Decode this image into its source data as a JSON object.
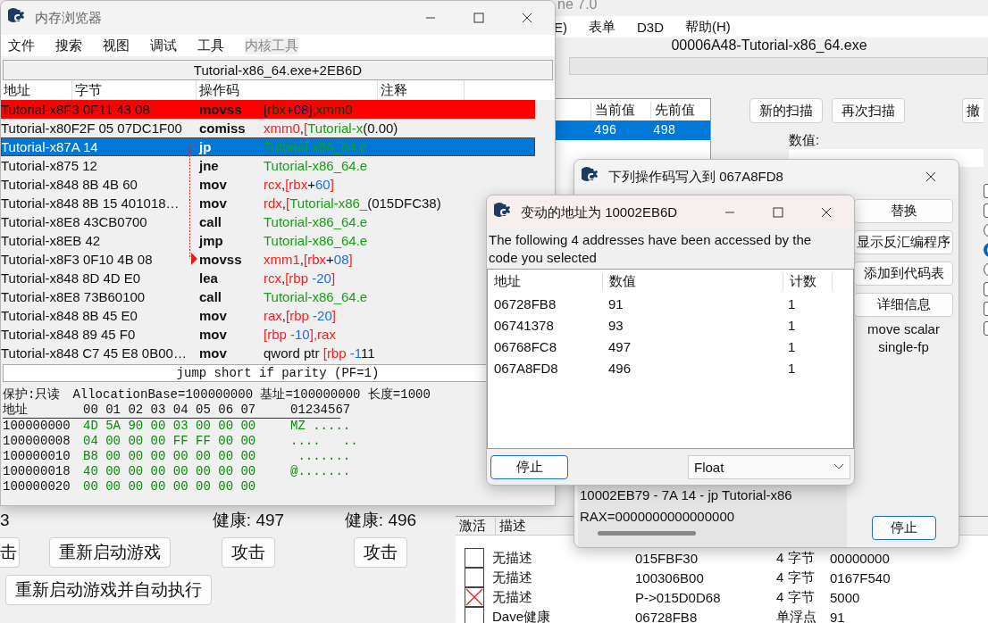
{
  "main_window": {
    "title": "ne 7.0",
    "menu": [
      "E)",
      "表单",
      "D3D",
      "帮助(H)"
    ],
    "process": "00006A48-Tutorial-x86_64.exe",
    "scan_list": {
      "columns": [
        "当前值",
        "先前值"
      ],
      "rows": [
        {
          "current": "496",
          "previous": "498",
          "selected": true
        }
      ]
    },
    "buttons": [
      "新的扫描",
      "再次扫描",
      "撤"
    ],
    "value_label": "数值:",
    "options": [
      {
        "kind": "checkbox",
        "checked": false
      },
      {
        "kind": "checkbox",
        "checked": false
      },
      {
        "kind": "radio",
        "checked": false
      },
      {
        "kind": "radio",
        "checked": true
      },
      {
        "kind": "radio",
        "checked": false
      },
      {
        "kind": "checkbox",
        "checked": false
      },
      {
        "kind": "checkbox",
        "checked": false
      },
      {
        "kind": "checkbox",
        "checked": false
      }
    ]
  },
  "tutorial": {
    "score": "3",
    "health": [
      "健康: 497",
      "健康: 496"
    ],
    "buttons": [
      "击",
      "重新启动游戏",
      "攻击",
      "攻击"
    ],
    "auto_button": "重新启动游戏并自动执行"
  },
  "address_list": {
    "columns": [
      "激活",
      "描述"
    ],
    "rows": [
      {
        "active": false,
        "description": "无描述",
        "address": "015FBF30",
        "type": "4 字节",
        "value": "00000000"
      },
      {
        "active": false,
        "description": "无描述",
        "address": "100306B00",
        "type": "4 字节",
        "value": "0167F540"
      },
      {
        "active": true,
        "description": "无描述",
        "address": "P->015D0D68",
        "type": "4 字节",
        "value": "5000"
      },
      {
        "active": false,
        "description": "Dave健康",
        "address": "06728FB8",
        "type": "单浮点",
        "value": "91"
      }
    ]
  },
  "opcode_dialog": {
    "title": "下列操作码写入到 067A8FD8",
    "buttons": [
      "替换",
      "显示反汇编程序",
      "添加到代码表",
      "详细信息"
    ],
    "description": "move scalar single-fp",
    "instruction": "10002EB79 - 7A 14 - jp Tutorial-x86",
    "registers": "RAX=0000000000000000",
    "stop_button": "停止"
  },
  "memory_viewer": {
    "title": "内存浏览器",
    "menu": [
      {
        "label": "文件",
        "disabled": false
      },
      {
        "label": "搜索",
        "disabled": false
      },
      {
        "label": "视图",
        "disabled": false
      },
      {
        "label": "调试",
        "disabled": false
      },
      {
        "label": "工具",
        "disabled": false
      },
      {
        "label": "内核工具",
        "disabled": true
      }
    ],
    "address": "Tutorial-x86_64.exe+2EB6D",
    "columns": [
      "地址",
      "字节",
      "操作码",
      "注释"
    ],
    "rows": [
      {
        "bytes": "Tutorial-x8F3 0F11 43 08",
        "opcode": "movss",
        "operand": [
          {
            "kind": "bracket",
            "text": "["
          },
          {
            "kind": "register",
            "text": "rbx"
          },
          {
            "kind": "plain",
            "text": "+"
          },
          {
            "kind": "number",
            "text": "08"
          },
          {
            "kind": "bracket",
            "text": "],"
          },
          {
            "kind": "register",
            "text": "xmm0"
          }
        ],
        "breakpoint": true,
        "selected": false,
        "jump_target": false
      },
      {
        "bytes": "Tutorial-x80F2F 05 07DC1F00",
        "opcode": "comiss",
        "operand": [
          {
            "kind": "register",
            "text": "xmm0"
          },
          {
            "kind": "plain",
            "text": ","
          },
          {
            "kind": "bracket",
            "text": "["
          },
          {
            "kind": "symbol",
            "text": "Tutorial-x"
          },
          {
            "kind": "plain",
            "text": "(0.00)"
          }
        ],
        "breakpoint": false,
        "selected": false,
        "jump_target": false
      },
      {
        "bytes": "Tutorial-x87A 14",
        "opcode": "jp",
        "operand": [
          {
            "kind": "symbol",
            "text": "Tutorial-x86_64.e"
          }
        ],
        "breakpoint": false,
        "selected": true,
        "jump_target": false
      },
      {
        "bytes": "Tutorial-x875 12",
        "opcode": "jne",
        "operand": [
          {
            "kind": "symbol",
            "text": "Tutorial-x86_64.e"
          }
        ],
        "breakpoint": false,
        "selected": false,
        "jump_target": false
      },
      {
        "bytes": "Tutorial-x848 8B 4B 60",
        "opcode": "mov",
        "operand": [
          {
            "kind": "register",
            "text": "rcx"
          },
          {
            "kind": "plain",
            "text": ","
          },
          {
            "kind": "bracket",
            "text": "["
          },
          {
            "kind": "register",
            "text": "rbx"
          },
          {
            "kind": "plain",
            "text": "+"
          },
          {
            "kind": "number",
            "text": "60"
          },
          {
            "kind": "bracket",
            "text": "]"
          }
        ],
        "breakpoint": false,
        "selected": false,
        "jump_target": false
      },
      {
        "bytes": "Tutorial-x848 8B 15 401018…",
        "opcode": "mov",
        "operand": [
          {
            "kind": "register",
            "text": "rdx"
          },
          {
            "kind": "plain",
            "text": ","
          },
          {
            "kind": "bracket",
            "text": "["
          },
          {
            "kind": "symbol",
            "text": "Tutorial-x86_"
          },
          {
            "kind": "plain",
            "text": "(015DFC38)"
          }
        ],
        "breakpoint": false,
        "selected": false,
        "jump_target": false
      },
      {
        "bytes": "Tutorial-x8E8 43CB0700",
        "opcode": "call",
        "operand": [
          {
            "kind": "symbol",
            "text": "Tutorial-x86_64.e"
          }
        ],
        "breakpoint": false,
        "selected": false,
        "jump_target": false
      },
      {
        "bytes": "Tutorial-x8EB 42",
        "opcode": "jmp",
        "operand": [
          {
            "kind": "symbol",
            "text": "Tutorial-x86_64.e"
          }
        ],
        "breakpoint": false,
        "selected": false,
        "jump_target": false
      },
      {
        "bytes": "Tutorial-x8F3 0F10 4B 08",
        "opcode": "movss",
        "operand": [
          {
            "kind": "register",
            "text": "xmm1"
          },
          {
            "kind": "plain",
            "text": ","
          },
          {
            "kind": "bracket",
            "text": "["
          },
          {
            "kind": "register",
            "text": "rbx"
          },
          {
            "kind": "plain",
            "text": "+"
          },
          {
            "kind": "number",
            "text": "08"
          },
          {
            "kind": "bracket",
            "text": "]"
          }
        ],
        "breakpoint": false,
        "selected": false,
        "jump_target": true
      },
      {
        "bytes": "Tutorial-x848 8D 4D E0",
        "opcode": "lea",
        "operand": [
          {
            "kind": "register",
            "text": "rcx"
          },
          {
            "kind": "plain",
            "text": ","
          },
          {
            "kind": "bracket",
            "text": "["
          },
          {
            "kind": "register",
            "text": "rbp"
          },
          {
            "kind": "number",
            "text": " -20"
          },
          {
            "kind": "bracket",
            "text": "]"
          }
        ],
        "breakpoint": false,
        "selected": false,
        "jump_target": false
      },
      {
        "bytes": "Tutorial-x8E8 73B60100",
        "opcode": "call",
        "operand": [
          {
            "kind": "symbol",
            "text": "Tutorial-x86_64.e"
          }
        ],
        "breakpoint": false,
        "selected": false,
        "jump_target": false
      },
      {
        "bytes": "Tutorial-x848 8B 45 E0",
        "opcode": "mov",
        "operand": [
          {
            "kind": "register",
            "text": "rax"
          },
          {
            "kind": "plain",
            "text": ","
          },
          {
            "kind": "bracket",
            "text": "["
          },
          {
            "kind": "register",
            "text": "rbp"
          },
          {
            "kind": "number",
            "text": " -20"
          },
          {
            "kind": "bracket",
            "text": "]"
          }
        ],
        "breakpoint": false,
        "selected": false,
        "jump_target": false
      },
      {
        "bytes": "Tutorial-x848 89 45 F0",
        "opcode": "mov",
        "operand": [
          {
            "kind": "bracket",
            "text": "["
          },
          {
            "kind": "register",
            "text": "rbp"
          },
          {
            "kind": "number",
            "text": " -10"
          },
          {
            "kind": "bracket",
            "text": "],"
          },
          {
            "kind": "register",
            "text": "rax"
          }
        ],
        "breakpoint": false,
        "selected": false,
        "jump_target": false
      },
      {
        "bytes": "Tutorial-x848 C7 45 E8 0B00…",
        "opcode": "mov",
        "operand": [
          {
            "kind": "plain",
            "text": "qword ptr "
          },
          {
            "kind": "bracket",
            "text": "["
          },
          {
            "kind": "register",
            "text": "rbp"
          },
          {
            "kind": "number",
            "text": " -1"
          },
          {
            "kind": "plain",
            "text": "11"
          }
        ],
        "breakpoint": false,
        "selected": false,
        "jump_target": false
      }
    ],
    "description": "jump short if parity (PF=1)",
    "hex": {
      "protection": "保护:只读",
      "info": "AllocationBase=100000000 基址=100000000 长度=1000",
      "header_label": "地址",
      "header_bytes": "00 01 02 03 04 05 06 07",
      "header_ascii": "01234567",
      "rows": [
        {
          "address": "100000000",
          "bytes": "4D 5A 90 00 03 00 00 00",
          "ascii": "MZ ....."
        },
        {
          "address": "100000008",
          "bytes": "04 00 00 00 FF FF 00 00",
          "ascii": "....   .."
        },
        {
          "address": "100000010",
          "bytes": "B8 00 00 00 00 00 00 00",
          "ascii": " ......."
        },
        {
          "address": "100000018",
          "bytes": "40 00 00 00 00 00 00 00",
          "ascii": "@......."
        },
        {
          "address": "100000020",
          "bytes": "00 00 00 00 00 00 00 00",
          "ascii": ""
        }
      ]
    }
  },
  "changed_dialog": {
    "title": "变动的地址为 10002EB6D",
    "message": "The following 4 addresses have been accessed by the code you selected",
    "columns": [
      "地址",
      "数值",
      "计数"
    ],
    "rows": [
      {
        "address": "06728FB8",
        "value": "91",
        "count": "1"
      },
      {
        "address": "06741378",
        "value": "93",
        "count": "1"
      },
      {
        "address": "06768FC8",
        "value": "497",
        "count": "1"
      },
      {
        "address": "067A8FD8",
        "value": "496",
        "count": "1"
      }
    ],
    "stop_button": "停止",
    "type_select": "Float"
  }
}
